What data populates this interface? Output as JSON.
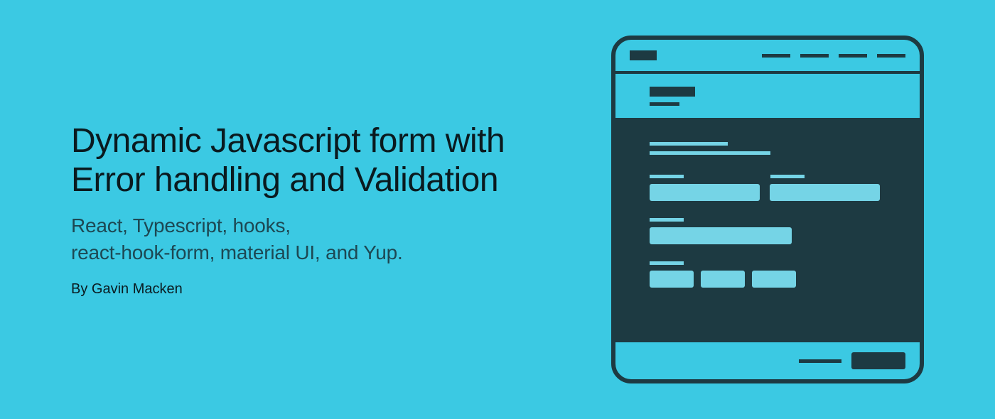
{
  "title": "Dynamic Javascript form with Error handling and Validation",
  "subtitle": "React, Typescript, hooks,\nreact-hook-form, material UI, and Yup.",
  "byline": "By Gavin Macken"
}
